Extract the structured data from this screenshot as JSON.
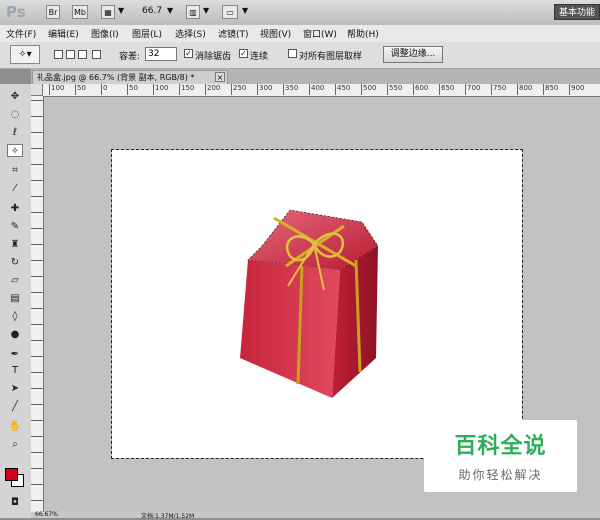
{
  "app": {
    "logo": "Ps",
    "mode_br": "Br",
    "mode_mb": "Mb",
    "zoom": "66.7",
    "workspace": "基本功能"
  },
  "menu": [
    "文件(F)",
    "编辑(E)",
    "图像(I)",
    "图层(L)",
    "选择(S)",
    "滤镜(T)",
    "视图(V)",
    "窗口(W)",
    "帮助(H)"
  ],
  "options": {
    "tolerance_label": "容差:",
    "tolerance_value": "32",
    "antialias_label": "消除锯齿",
    "contiguous_label": "连续",
    "sample_all_label": "对所有图层取样",
    "refine_button": "调整边缘..."
  },
  "document": {
    "tab_title": "礼品盒.jpg @ 66.7% (背景 副本, RGB/8) *",
    "close": "×"
  },
  "ruler": {
    "top_labels": [
      "100",
      "50",
      "0",
      "50",
      "100",
      "150",
      "200",
      "250",
      "300",
      "350",
      "400",
      "450",
      "500",
      "550",
      "600",
      "650",
      "700",
      "750",
      "800",
      "850",
      "900"
    ]
  },
  "status": {
    "left": "66.67%",
    "doc": "文档:1.37M/1.52M"
  },
  "colors": {
    "foreground": "#d0021b",
    "background": "#ffffff"
  },
  "watermark": {
    "title": "百科全说",
    "subtitle": "助你轻松解决"
  },
  "tools": [
    "move-tool-icon",
    "marquee-tool-icon",
    "lasso-tool-icon",
    "magic-wand-icon",
    "crop-tool-icon",
    "eyedropper-icon",
    "healing-brush-icon",
    "brush-icon",
    "stamp-icon",
    "history-brush-icon",
    "eraser-icon",
    "gradient-icon",
    "blur-icon",
    "dodge-icon",
    "pen-icon",
    "type-icon",
    "path-select-icon",
    "line-icon",
    "hand-icon",
    "zoom-icon"
  ]
}
